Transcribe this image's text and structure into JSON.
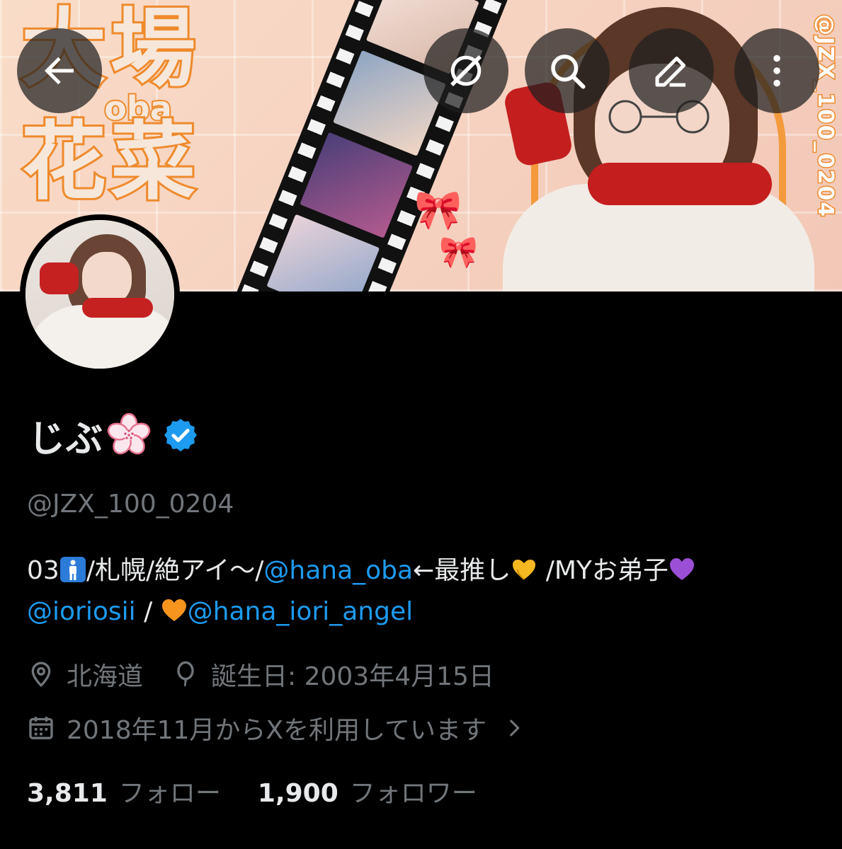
{
  "banner": {
    "title_top": "大場",
    "title_romaji": "oba",
    "title_bottom": "花菜",
    "vertical_text": "@JZX_100_0204"
  },
  "top_buttons": [
    {
      "name": "back-arrow-icon"
    },
    {
      "name": "grok-icon"
    },
    {
      "name": "search-icon"
    },
    {
      "name": "edit-icon"
    },
    {
      "name": "more-vertical-icon"
    }
  ],
  "profile": {
    "display_name": "じぶ",
    "name_emoji": "cherry-blossom-icon",
    "verified": true,
    "handle": "@JZX_100_0204",
    "bio": {
      "t1": "03",
      "t2": "/札幌/絶アイ～/",
      "link1": "@hana_oba",
      "t3": "←最推し",
      "t4": " /MYお弟子",
      "link2": "@ioriosii",
      "t5": " / ",
      "link3": "@hana_iori_angel"
    },
    "location": "北海道",
    "birthday": "誕生日: 2003年4月15日",
    "joined": "2018年11月からXを利用しています",
    "following_count": "3,811",
    "following_label": "フォロー",
    "followers_count": "1,900",
    "followers_label": "フォロワー"
  },
  "colors": {
    "link": "#1d9bf0",
    "muted": "#71767b",
    "text": "#e7e9ea",
    "verified": "#1d9bf0",
    "banner_accent": "#ef8a2c"
  }
}
